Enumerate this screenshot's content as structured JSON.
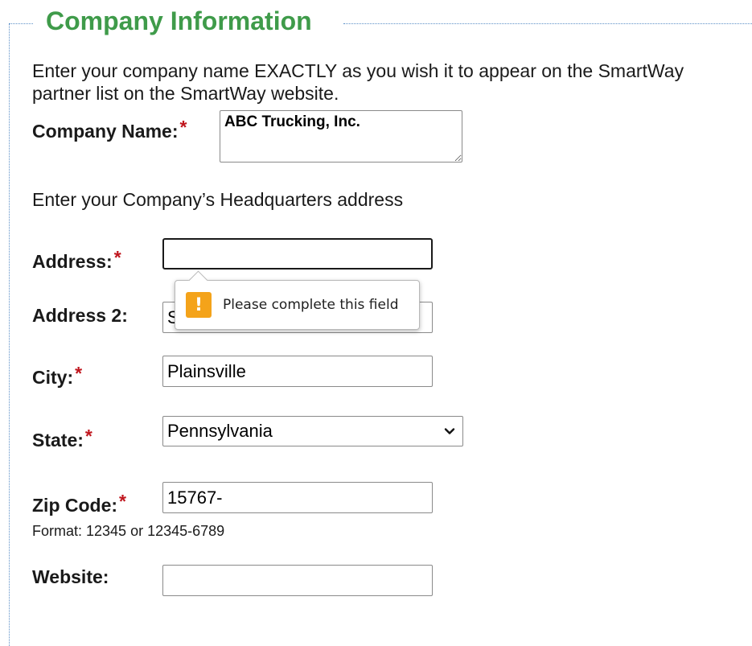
{
  "colors": {
    "legend": "#3f9b4a",
    "required_star": "#c0161e",
    "warning_icon_bg": "#f4a31a"
  },
  "section": {
    "legend": "Company Information",
    "intro": "Enter your company name EXACTLY as you wish it to appear on the SmartWay partner list on the SmartWay website.",
    "hq_instructions": "Enter your Company’s Headquarters address"
  },
  "required_marker": "*",
  "fields": {
    "company_name": {
      "label": "Company Name:",
      "value": "ABC Trucking, Inc."
    },
    "address": {
      "label": "Address:",
      "value": ""
    },
    "address2": {
      "label": "Address 2:",
      "value": "S"
    },
    "city": {
      "label": "City:",
      "value": "Plainsville"
    },
    "state": {
      "label": "State:",
      "selected": "Pennsylvania"
    },
    "zip": {
      "label": "Zip Code:",
      "value": "15767-",
      "format_hint": "Format: 12345 or 12345-6789"
    },
    "website": {
      "label": "Website:",
      "value": ""
    }
  },
  "validation_tooltip": {
    "icon": "warning-icon",
    "icon_glyph": "!",
    "message": "Please complete this field"
  }
}
